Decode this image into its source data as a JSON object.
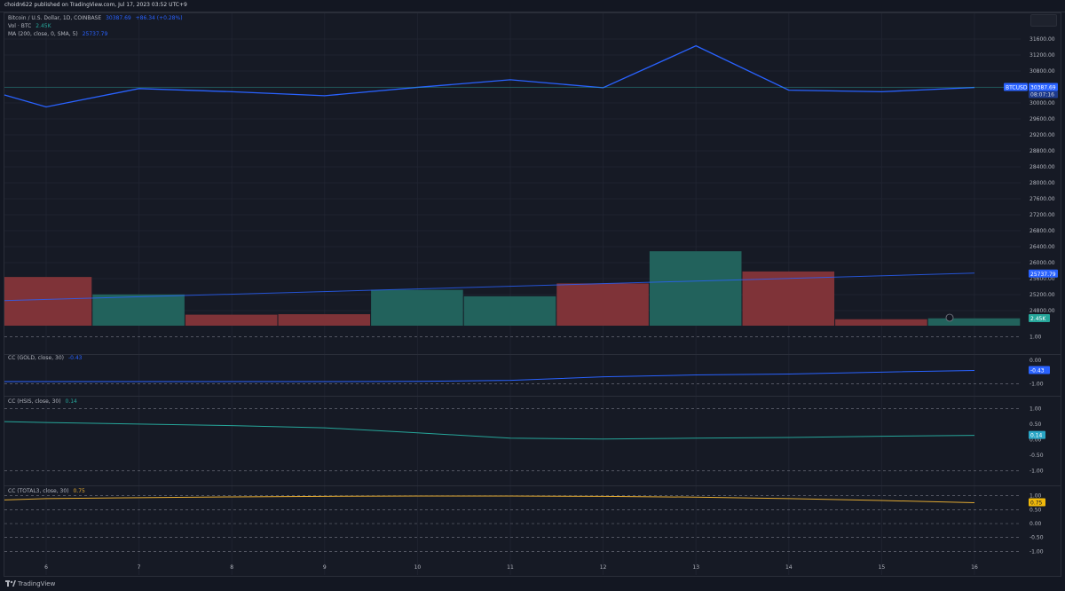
{
  "header": {
    "published": "choidn622 published on TradingView.com, Jul 17, 2023 03:52 UTC+9"
  },
  "legend": {
    "main_title": "Bitcoin / U.S. Dollar, 1D, COINBASE",
    "main_price": "30387.69",
    "main_change": "+86.34 (+0.28%)",
    "vol_title": "Vol · BTC",
    "vol_value": "2.45K",
    "ma_title": "MA (200, close, 0, SMA, 5)",
    "ma_value": "25737.79",
    "cc1_title": "CC (GOLD, close, 30)",
    "cc1_value": "-0.43",
    "cc2_title": "CC (HSIS, close, 30)",
    "cc2_value": "0.14",
    "cc3_title": "CC (TOTAL3, close, 30)",
    "cc3_value": "0.75"
  },
  "price_tags": {
    "symbol": "BTCUSD",
    "price": "30387.69",
    "countdown": "08:07:16",
    "ma": "25737.79",
    "vol": "2.45K",
    "cc1": "-0.43",
    "cc2": "0.14",
    "cc3": "0.75"
  },
  "footer": {
    "brand": "TradingView"
  },
  "colors": {
    "background": "#131722",
    "pane": "#161a25",
    "grid": "#1f2330",
    "axis_text": "#b2b5be",
    "price_line": "#2962ff",
    "ma_line": "#2962ff",
    "vol_up": "#22625c",
    "vol_down": "#7f3338",
    "cc1": "#2962ff",
    "cc2": "#26a69a",
    "cc3": "#e0a832",
    "price_tag": "#2962ff",
    "vol_tag": "#26a69a",
    "cc2_tag": "#2aa6c6",
    "cc3_tag": "#f0b90b"
  },
  "chart_data": [
    {
      "type": "line",
      "name": "BTCUSD",
      "x": [
        "5",
        "6",
        "7",
        "8",
        "9",
        "10",
        "11",
        "12",
        "13",
        "14",
        "15",
        "16"
      ],
      "values": [
        30200,
        29900,
        30360,
        30280,
        30180,
        30390,
        30580,
        30380,
        31430,
        30320,
        30280,
        30387.69
      ],
      "ylim": [
        24500,
        31700
      ],
      "yticks": [
        "31600.00",
        "31200.00",
        "30800.00",
        "30400.00",
        "30000.00",
        "29600.00",
        "29200.00",
        "28800.00",
        "28400.00",
        "28000.00",
        "27600.00",
        "27200.00",
        "26800.00",
        "26400.00",
        "26000.00",
        "25600.00",
        "25200.00",
        "24800.00"
      ],
      "xticks": [
        "6",
        "7",
        "8",
        "9",
        "10",
        "11",
        "12",
        "13",
        "14",
        "15",
        "16"
      ]
    },
    {
      "type": "bar",
      "name": "Volume",
      "x": [
        "6",
        "7",
        "8",
        "9",
        "10",
        "11",
        "12",
        "13",
        "14",
        "15",
        "16"
      ],
      "values": [
        5.3,
        3.4,
        1.2,
        1.25,
        3.9,
        3.2,
        4.6,
        8.1,
        5.9,
        0.7,
        0.8
      ],
      "up": [
        false,
        true,
        false,
        false,
        true,
        true,
        false,
        true,
        false,
        false,
        true
      ],
      "ymax": 8.5
    },
    {
      "type": "line",
      "name": "MA (200, close, 0, SMA, 5)",
      "x": [
        "6",
        "16"
      ],
      "values": [
        25050,
        25737.79
      ]
    },
    {
      "type": "line",
      "name": "CC (GOLD, close, 30)",
      "x": [
        "5",
        "6",
        "7",
        "8",
        "9",
        "10",
        "11",
        "12",
        "13",
        "14",
        "15",
        "16"
      ],
      "values": [
        -0.9,
        -0.9,
        -0.9,
        -0.9,
        -0.9,
        -0.89,
        -0.85,
        -0.7,
        -0.62,
        -0.58,
        -0.5,
        -0.43
      ],
      "ylim": [
        -1.2,
        1.2
      ],
      "yticks": [
        "1.00",
        "0.00",
        "-1.00"
      ]
    },
    {
      "type": "line",
      "name": "CC (HSIS, close, 30)",
      "x": [
        "5",
        "6",
        "7",
        "8",
        "9",
        "10",
        "11",
        "12",
        "13",
        "14",
        "15",
        "16"
      ],
      "values": [
        0.58,
        0.55,
        0.5,
        0.45,
        0.38,
        0.22,
        0.05,
        0.02,
        0.05,
        0.07,
        0.11,
        0.14
      ],
      "ylim": [
        -1.15,
        1.15
      ],
      "yticks": [
        "1.00",
        "0.50",
        "0.00",
        "-0.50",
        "-1.00"
      ]
    },
    {
      "type": "line",
      "name": "CC (TOTAL3, close, 30)",
      "x": [
        "5",
        "6",
        "7",
        "8",
        "9",
        "10",
        "11",
        "12",
        "13",
        "14",
        "15",
        "16"
      ],
      "values": [
        0.85,
        0.9,
        0.93,
        0.96,
        0.98,
        0.99,
        0.99,
        0.98,
        0.95,
        0.9,
        0.83,
        0.75
      ],
      "ylim": [
        -1.15,
        1.15
      ],
      "yticks": [
        "1.00",
        "0.50",
        "0.00",
        "-0.50",
        "-1.00"
      ]
    }
  ]
}
